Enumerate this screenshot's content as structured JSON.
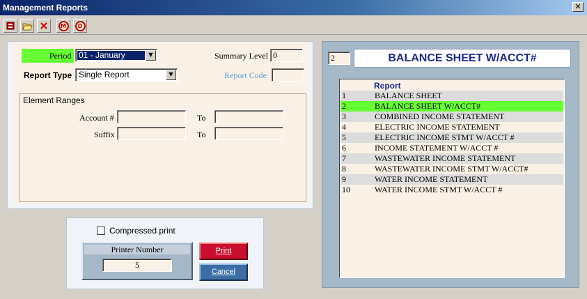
{
  "window": {
    "title": "Management Reports"
  },
  "toolbar": {
    "buttons": [
      {
        "name": "exit-icon",
        "glyph": "▣"
      },
      {
        "name": "open-folder-icon",
        "glyph": "📂"
      },
      {
        "name": "delete-icon",
        "glyph": "✕"
      },
      {
        "name": "m-circle-icon",
        "glyph": "M"
      },
      {
        "name": "d-circle-icon",
        "glyph": "D"
      }
    ]
  },
  "form": {
    "period_label": "Period",
    "period_value": "01 - January",
    "summary_level_label": "Summary Level",
    "summary_level_value": "0",
    "report_type_label": "Report Type",
    "report_type_value": "Single Report",
    "report_code_label": "Report Code",
    "report_code_value": ""
  },
  "element_ranges": {
    "title": "Element Ranges",
    "account_label": "Account #",
    "suffix_label": "Suffix",
    "to_label": "To"
  },
  "print": {
    "compressed_label": "Compressed print",
    "compressed_checked": false,
    "printer_number_label": "Printer Number",
    "printer_number_value": "5",
    "print_button": "Print",
    "cancel_button": "Cancel"
  },
  "report_panel": {
    "selected_number": "2",
    "selected_title": "BALANCE SHEET W/ACCT#",
    "list_header": "Report",
    "rows": [
      {
        "n": "1",
        "name": "BALANCE SHEET"
      },
      {
        "n": "2",
        "name": "BALANCE SHEET W/ACCT#"
      },
      {
        "n": "3",
        "name": "COMBINED INCOME STATEMENT"
      },
      {
        "n": "4",
        "name": "ELECTRIC INCOME STATEMENT"
      },
      {
        "n": "5",
        "name": "ELECTRIC INCOME STMT W/ACCT #"
      },
      {
        "n": "6",
        "name": "INCOME STATEMENT W/ACCT #"
      },
      {
        "n": "7",
        "name": "WASTEWATER INCOME STATEMENT"
      },
      {
        "n": "8",
        "name": "WASTEWATER INCOME STMT W/ACCT#"
      },
      {
        "n": "9",
        "name": "WATER INCOME STATEMENT"
      },
      {
        "n": "10",
        "name": "WATER INCOME STMT W/ACCT #"
      }
    ]
  },
  "colors": {
    "period_highlight": "#66ff33",
    "selected_row": "#66ff33",
    "alt_row": "#dcdcdc",
    "print_button": "#c8102e",
    "cancel_button": "#3a6ea5",
    "report_panel_bg": "#a4b8c8",
    "report_title": "#1a2a8a"
  }
}
